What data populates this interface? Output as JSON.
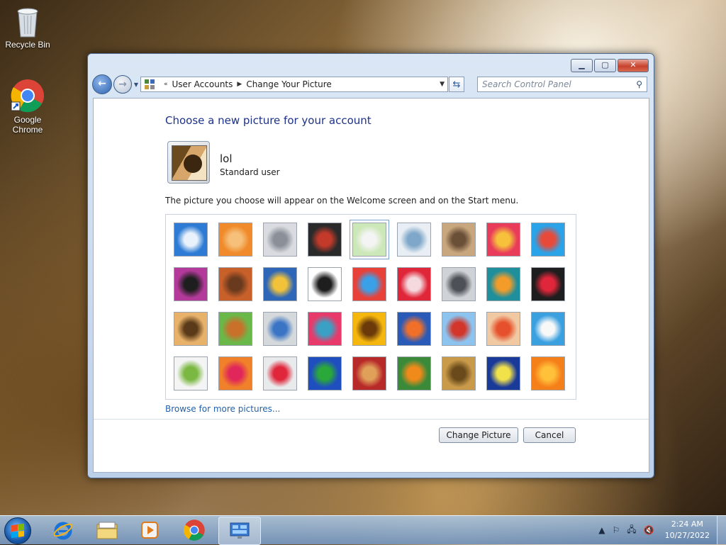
{
  "desktop": {
    "icons": [
      {
        "label": "Recycle Bin",
        "icon": "recycle-bin-icon"
      },
      {
        "label": "Google\nChrome",
        "icon": "chrome-icon"
      }
    ]
  },
  "window": {
    "breadcrumb": [
      "User Accounts",
      "Change Your Picture"
    ],
    "search_placeholder": "Search Control Panel",
    "heading": "Choose a new picture for your account",
    "user": {
      "name": "lol",
      "type": "Standard user"
    },
    "description": "The picture you choose will appear on the Welcome screen and on the Start menu.",
    "selected_index": 4,
    "pictures": [
      {
        "name": "roller-coaster",
        "colors": [
          "#2d7bd4",
          "#e9f2fb"
        ]
      },
      {
        "name": "starfish",
        "colors": [
          "#f08a2a",
          "#f6c07a"
        ]
      },
      {
        "name": "robot-toy",
        "colors": [
          "#d9dbe0",
          "#8a8f98"
        ]
      },
      {
        "name": "turntable",
        "colors": [
          "#2a2a2a",
          "#c43a2a"
        ]
      },
      {
        "name": "lucky-cat",
        "colors": [
          "#cde8b8",
          "#f4f4f4"
        ]
      },
      {
        "name": "gyroscope",
        "colors": [
          "#e8eef4",
          "#7fa7c9"
        ]
      },
      {
        "name": "kitten",
        "colors": [
          "#c9a77e",
          "#6a5037"
        ]
      },
      {
        "name": "flower-pink",
        "colors": [
          "#e83c5a",
          "#f6c23b"
        ]
      },
      {
        "name": "pinwheel",
        "colors": [
          "#2aa3e8",
          "#e84a3a"
        ]
      },
      {
        "name": "ball-magenta",
        "colors": [
          "#b33a9a",
          "#1e1e1e"
        ]
      },
      {
        "name": "fabric-stripes",
        "colors": [
          "#c8602a",
          "#6a3a1e"
        ]
      },
      {
        "name": "leaf-blue",
        "colors": [
          "#2f67b8",
          "#f2c33a"
        ]
      },
      {
        "name": "dog-border-collie",
        "colors": [
          "#ffffff",
          "#1e1e1e"
        ]
      },
      {
        "name": "crayons",
        "colors": [
          "#e8413a",
          "#3aa0e8"
        ]
      },
      {
        "name": "paper-star",
        "colors": [
          "#e0273a",
          "#f4d9de"
        ]
      },
      {
        "name": "jacks",
        "colors": [
          "#cfd2d6",
          "#4d5157"
        ]
      },
      {
        "name": "stairs-teal",
        "colors": [
          "#1f8f9c",
          "#f39c2a"
        ]
      },
      {
        "name": "paper-crane",
        "colors": [
          "#1e1e1e",
          "#e0263a"
        ]
      },
      {
        "name": "guitar",
        "colors": [
          "#e9b26a",
          "#5a3a18"
        ]
      },
      {
        "name": "pomeranian",
        "colors": [
          "#6bb84a",
          "#c9702a"
        ]
      },
      {
        "name": "tin-robot",
        "colors": [
          "#d6d9db",
          "#3a74c4"
        ]
      },
      {
        "name": "silk-scarves",
        "colors": [
          "#e83a6a",
          "#3aa0c4"
        ]
      },
      {
        "name": "sunflower",
        "colors": [
          "#f5b60e",
          "#6a3a0a"
        ]
      },
      {
        "name": "goldfish",
        "colors": [
          "#2a5ab8",
          "#f0702a"
        ]
      },
      {
        "name": "hot-air-balloon",
        "colors": [
          "#8cc4ef",
          "#d2362a"
        ]
      },
      {
        "name": "daruma-doll",
        "colors": [
          "#f0c8a2",
          "#e6502a"
        ]
      },
      {
        "name": "sailboat",
        "colors": [
          "#3aa0e0",
          "#f8f8f8"
        ]
      },
      {
        "name": "soccer-ball",
        "colors": [
          "#f4f4f4",
          "#7ab842"
        ]
      },
      {
        "name": "orange-fabric",
        "colors": [
          "#f0802a",
          "#e0265a"
        ]
      },
      {
        "name": "marbles",
        "colors": [
          "#e8eaec",
          "#e0263a"
        ]
      },
      {
        "name": "green-window",
        "colors": [
          "#1f4fbf",
          "#2aa83a"
        ]
      },
      {
        "name": "woven-textile",
        "colors": [
          "#b82a2a",
          "#e0a05a"
        ]
      },
      {
        "name": "butterfly",
        "colors": [
          "#3a8a3a",
          "#f08a1a"
        ]
      },
      {
        "name": "wicker-basket",
        "colors": [
          "#c89a4a",
          "#6a4a1a"
        ]
      },
      {
        "name": "lighthouse",
        "colors": [
          "#1a3a9a",
          "#f2e24a"
        ]
      },
      {
        "name": "orange-gerbera",
        "colors": [
          "#f5801a",
          "#ffc03a"
        ]
      }
    ],
    "browse_link": "Browse for more pictures...",
    "buttons": {
      "change": "Change Picture",
      "cancel": "Cancel"
    }
  },
  "taskbar": {
    "clock_time": "2:24 AM",
    "clock_date": "10/27/2022"
  }
}
